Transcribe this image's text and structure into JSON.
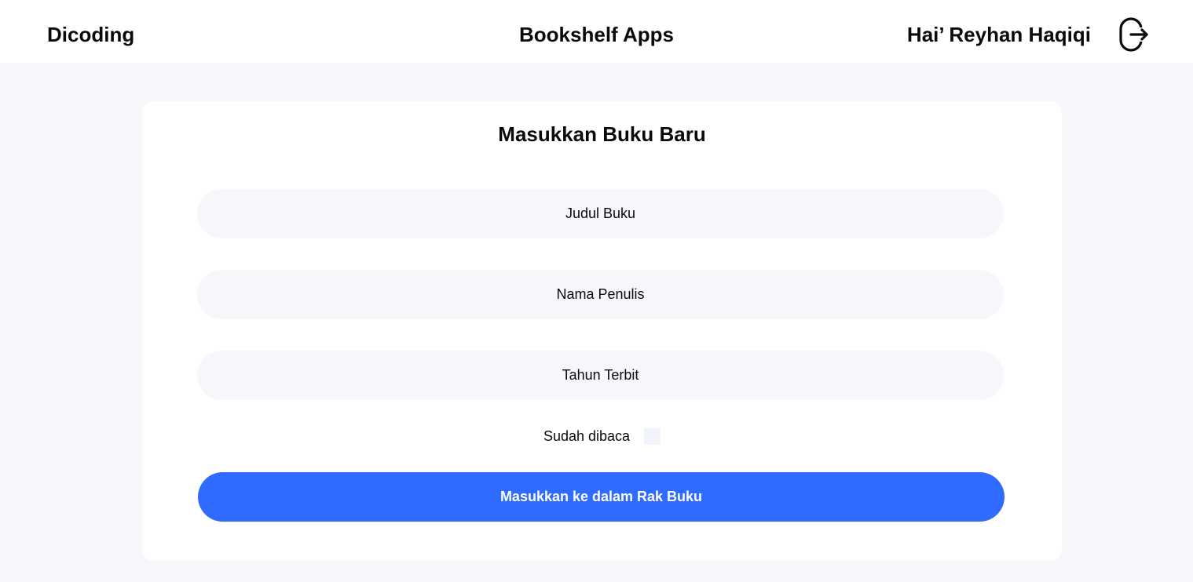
{
  "navbar": {
    "brand": "Dicoding",
    "app_title": "Bookshelf Apps",
    "greeting": "Hai’ Reyhan Haqiqi",
    "logout_icon": "logout-icon"
  },
  "form": {
    "title": "Masukkan Buku Baru",
    "book_title_placeholder": "Judul Buku",
    "author_placeholder": "Nama Penulis",
    "year_placeholder": "Tahun Terbit",
    "read_label": "Sudah dibaca",
    "read_checked": false,
    "submit_label": "Masukkan ke dalam Rak Buku"
  },
  "colors": {
    "background": "#f6f7fb",
    "surface": "#ffffff",
    "input_bg": "#f6f7fb",
    "accent": "#2f6bff",
    "text": "#0a0a0a"
  }
}
